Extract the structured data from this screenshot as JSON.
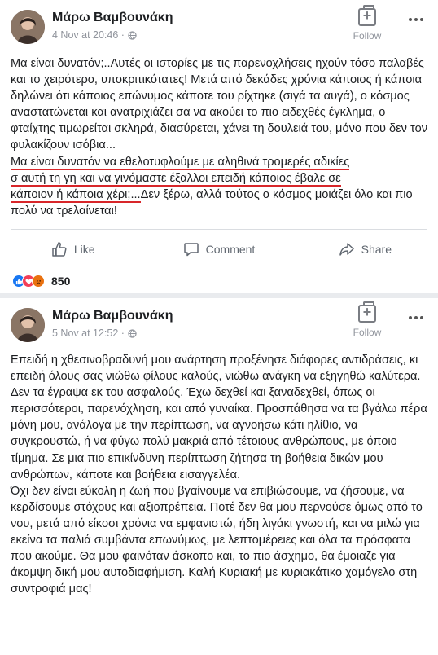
{
  "posts": [
    {
      "author": "Μάρω Βαμβουνάκη",
      "timestamp": "4 Nov at 20:46 · ",
      "follow_label": "Follow",
      "text_plain": "Μα είναι δυνατόν;..Αυτές οι ιστορίες με τις παρενοχλήσεις ηχούν τόσο παλαβές και το χειρότερο, υποκριτικότατες! Μετά από δεκάδες χρόνια κάποιος ή κάποια δηλώνει ότι κάποιος επώνυμος κάποτε του ρίχτηκε (σιγά τα αυγά), ο κόσμος αναστατώνεται και ανατριχιάζει σα να ακούει το πιο ειδεχθές έγκλημα, ο φταίχτης τιμωρείται σκληρά, διασύρεται, χάνει τη δουλειά του, μόνο που δεν τον φυλακίζουν ισόβια...",
      "text_underlined_1": "Μα είναι δυνατόν να εθελοτυφλούμε με αληθινά τρομερές αδικίες",
      "text_underlined_2": "σ αυτή τη γη και να γινόμαστε έξαλλοι επειδή κάποιος έβαλε σε",
      "text_underlined_3": "κάποιον ή κάποια χέρι;...",
      "text_tail": "Δεν ξέρω, αλλά τούτος ο κόσμος μοιάζει όλο και πιο πολύ να τρελαίνεται!",
      "actions": {
        "like": "Like",
        "comment": "Comment",
        "share": "Share"
      },
      "reaction_count": "850"
    },
    {
      "author": "Μάρω Βαμβουνάκη",
      "timestamp": "5 Nov at 12:52 · ",
      "follow_label": "Follow",
      "text": "Επειδή η χθεσινοβραδυνή μου ανάρτηση προξένησε διάφορες αντιδράσεις, κι επειδή όλους σας νιώθω φίλους καλούς, νιώθω ανάγκη να εξηγηθώ καλύτερα. Δεν τα έγραψα εκ του ασφαλούς. Έχω δεχθεί και ξαναδεχθεί, όπως οι περισσότεροι, παρενόχληση, και από γυναίκα. Προσπάθησα να τα βγάλω πέρα μόνη μου, ανάλογα με την περίπτωση, να αγνοήσω κάτι ηλίθιο, να συγκρουστώ, ή να φύγω πολύ μακριά από τέτοιους ανθρώπους, με όποιο τίμημα. Σε μια πιο επικίνδυνη περίπτωση ζήτησα τη βοήθεια δικών μου ανθρώπων, κάποτε και βοήθεια εισαγγελέα.\nΌχι δεν είναι εύκολη η ζωή που βγαίνουμε να επιβιώσουμε, να ζήσουμε, να κερδίσουμε στόχους και αξιοπρέπεια. Ποτέ δεν θα μου περνούσε όμως από το νου, μετά από είκοσι χρόνια να εμφανιστώ, ήδη λιγάκι γνωστή, και να μιλώ για εκείνα τα παλιά συμβάντα επωνύμως, με λεπτομέρειες και όλα τα πρόσφατα που ακούμε. Θα μου φαινόταν άσκοπο και, το πιο άσχημο, θα έμοιαζε για άκομψη δική μου αυτοδιαφήμιση. Καλή Κυριακή με κυριακάτικο χαμόγελο στη συντροφιά μας!"
    }
  ],
  "icons": {
    "privacy": "globe-icon",
    "follow": "follow-bookmark-icon",
    "more": "more-dots-icon",
    "like": "thumbs-up-icon",
    "comment": "comment-bubble-icon",
    "share": "share-arrow-icon"
  },
  "colors": {
    "underline": "#d8262a",
    "like": "#1877f2",
    "love": "#f33e58",
    "angry": "#e9710f"
  }
}
